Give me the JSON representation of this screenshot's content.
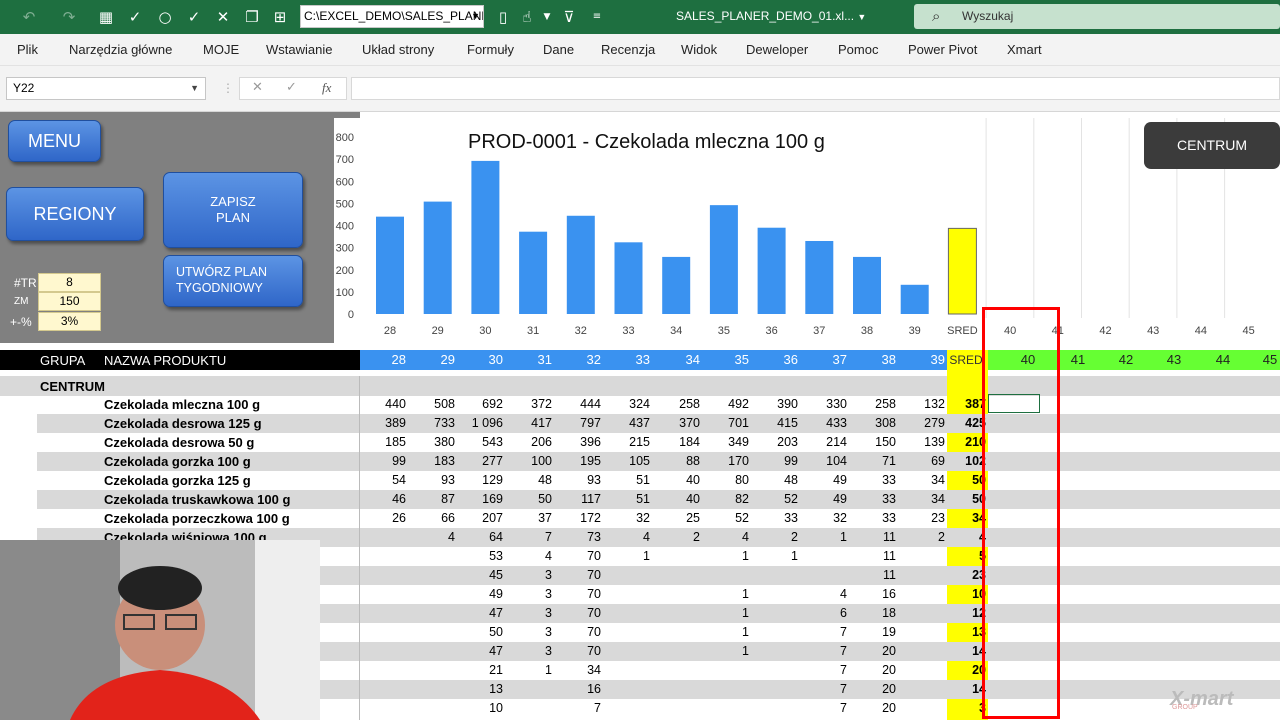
{
  "titlebar": {
    "path": "C:\\EXCEL_DEMO\\SALES_PLANE",
    "doc_title": "SALES_PLANER_DEMO_01.xl...",
    "search_placeholder": "Wyszukaj",
    "icons": [
      "undo-icon",
      "redo-icon",
      "grid-icon",
      "check-circle-icon",
      "circle-icon",
      "check-icon",
      "close-icon",
      "copy-icon",
      "hierarchy-icon",
      "new-doc-icon",
      "touch-icon",
      "filter-icon",
      "customize-icon"
    ]
  },
  "menu": [
    "Plik",
    "Narzędzia główne",
    "MOJE",
    "Wstawianie",
    "Układ strony",
    "Formuły",
    "Dane",
    "Recenzja",
    "Widok",
    "Deweloper",
    "Pomoc",
    "Power Pivot",
    "Xmart"
  ],
  "formula": {
    "cell_ref": "Y22",
    "fx": "fx",
    "value": ""
  },
  "panel": {
    "menu_btn": "MENU",
    "regiony_btn": "REGIONY",
    "zapisz_btn": "ZAPISZ PLAN",
    "utworz_btn": "UTWÓRZ PLAN TYGODNIOWY",
    "centrum_btn": "CENTRUM",
    "params": [
      {
        "label": "#TR",
        "value": "8"
      },
      {
        "label": "ZM",
        "value": "150"
      },
      {
        "label": "+-%",
        "value": "3%"
      }
    ]
  },
  "chart_data": {
    "type": "bar",
    "title": "PROD-0001  -  Czekolada  mleczna 100 g",
    "categories": [
      "28",
      "29",
      "30",
      "31",
      "32",
      "33",
      "34",
      "35",
      "36",
      "37",
      "38",
      "39",
      "SRED",
      "40",
      "41",
      "42",
      "43",
      "44",
      "45"
    ],
    "values": [
      440,
      508,
      692,
      372,
      444,
      324,
      258,
      492,
      390,
      330,
      258,
      132,
      387,
      null,
      null,
      null,
      null,
      null,
      null
    ],
    "yticks": [
      "0",
      "100",
      "200",
      "300",
      "400",
      "500",
      "600",
      "700",
      "800"
    ],
    "ylim": [
      0,
      800
    ],
    "highlight_category": "SRED",
    "colors": {
      "bar": "#3a92f0",
      "highlight": "#ffff00"
    }
  },
  "table": {
    "header_grupa": "GRUPA",
    "header_nazwa": "NAZWA PRODUKTU",
    "weeks": [
      "28",
      "29",
      "30",
      "31",
      "32",
      "33",
      "34",
      "35",
      "36",
      "37",
      "38",
      "39",
      "SRED"
    ],
    "future_weeks": [
      "40",
      "41",
      "42",
      "43",
      "44",
      "45"
    ],
    "group_label": "CENTRUM",
    "rows": [
      {
        "name": "Czekolada  mleczna 100 g",
        "vals": [
          "440",
          "508",
          "692",
          "372",
          "444",
          "324",
          "258",
          "492",
          "390",
          "330",
          "258",
          "132",
          "387"
        ]
      },
      {
        "name": "Czekolada  desrowa 125 g",
        "vals": [
          "389",
          "733",
          "1 096",
          "417",
          "797",
          "437",
          "370",
          "701",
          "415",
          "433",
          "308",
          "279",
          "425"
        ]
      },
      {
        "name": "Czekolada  desrowa 50 g",
        "vals": [
          "185",
          "380",
          "543",
          "206",
          "396",
          "215",
          "184",
          "349",
          "203",
          "214",
          "150",
          "139",
          "210"
        ]
      },
      {
        "name": "Czekolada  gorzka 100 g",
        "vals": [
          "99",
          "183",
          "277",
          "100",
          "195",
          "105",
          "88",
          "170",
          "99",
          "104",
          "71",
          "69",
          "102"
        ]
      },
      {
        "name": "Czekolada  gorzka 125 g",
        "vals": [
          "54",
          "93",
          "129",
          "48",
          "93",
          "51",
          "40",
          "80",
          "48",
          "49",
          "33",
          "34",
          "50"
        ]
      },
      {
        "name": "Czekolada  truskawkowa 100 g",
        "vals": [
          "46",
          "87",
          "169",
          "50",
          "117",
          "51",
          "40",
          "82",
          "52",
          "49",
          "33",
          "34",
          "50"
        ]
      },
      {
        "name": "Czekolada  porzeczkowa 100 g",
        "vals": [
          "26",
          "66",
          "207",
          "37",
          "172",
          "32",
          "25",
          "52",
          "33",
          "32",
          "33",
          "23",
          "34"
        ]
      },
      {
        "name": "Czekolada  wiśniowa 100 g",
        "vals": [
          "",
          "4",
          "64",
          "7",
          "73",
          "4",
          "2",
          "4",
          "2",
          "1",
          "11",
          "2",
          "4"
        ]
      },
      {
        "name": "",
        "vals": [
          "",
          "",
          "53",
          "4",
          "70",
          "1",
          "",
          "1",
          "1",
          "",
          "11",
          "",
          "5"
        ]
      },
      {
        "name": "",
        "vals": [
          "",
          "",
          "45",
          "3",
          "70",
          "",
          "",
          "",
          "",
          "",
          "11",
          "",
          "23"
        ]
      },
      {
        "name": "",
        "vals": [
          "",
          "",
          "49",
          "3",
          "70",
          "",
          "",
          "1",
          "",
          "4",
          "16",
          "",
          "10"
        ]
      },
      {
        "name": "",
        "vals": [
          "",
          "",
          "47",
          "3",
          "70",
          "",
          "",
          "1",
          "",
          "6",
          "18",
          "",
          "12"
        ]
      },
      {
        "name": "",
        "vals": [
          "",
          "",
          "50",
          "3",
          "70",
          "",
          "",
          "1",
          "",
          "7",
          "19",
          "",
          "13"
        ]
      },
      {
        "name": "",
        "vals": [
          "",
          "",
          "47",
          "3",
          "70",
          "",
          "",
          "1",
          "",
          "7",
          "20",
          "",
          "14"
        ]
      },
      {
        "name": "",
        "vals": [
          "",
          "",
          "21",
          "1",
          "34",
          "",
          "",
          "",
          "",
          "7",
          "20",
          "",
          "20"
        ]
      },
      {
        "name": "",
        "vals": [
          "",
          "",
          "13",
          "",
          "16",
          "",
          "",
          "",
          "",
          "7",
          "20",
          "",
          "14"
        ]
      },
      {
        "name": "",
        "vals": [
          "",
          "",
          "10",
          "",
          "7",
          "",
          "",
          "",
          "",
          "7",
          "20",
          "",
          "3"
        ]
      }
    ]
  },
  "watermark": "X-mart",
  "watermark_sub": "GROUP"
}
